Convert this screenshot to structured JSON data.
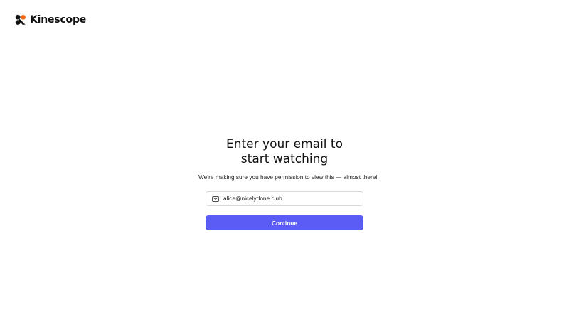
{
  "brand": {
    "name": "Kinescope",
    "logo_icon": "kinescope-logo-icon",
    "colors": {
      "mark_dark": "#111111",
      "mark_accent": "#f26a1b"
    }
  },
  "form": {
    "title_line1": "Enter your email to",
    "title_line2": "start watching",
    "subtitle": "We’re making sure you have permission to view this — almost there!",
    "email": {
      "icon": "mail-icon",
      "value": "alice@nicelydone.club"
    },
    "continue_label": "Continue",
    "accent_color": "#5b5cf5"
  }
}
